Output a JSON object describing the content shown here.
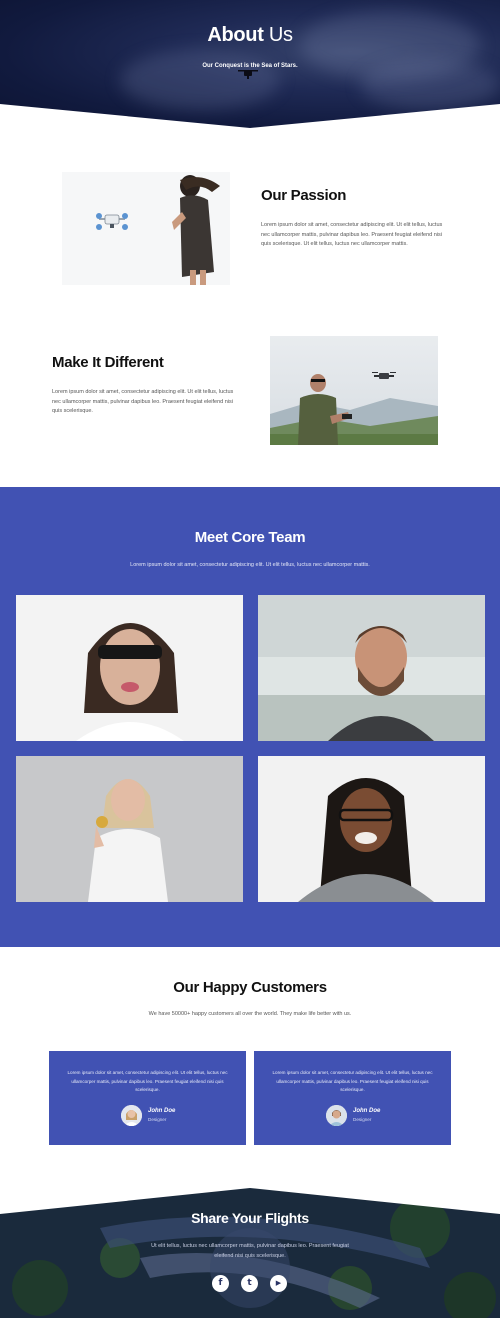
{
  "hero": {
    "title_bold": "About",
    "title_light": " Us",
    "subtitle": "Our Conquest is the Sea of Stars."
  },
  "passion": {
    "heading": "Our Passion",
    "text": "Lorem ipsum dolor sit amet, consectetur adipiscing elit. Ut elit tellus, luctus nec ullamcorper mattis, pulvinar dapibus leo. Praesent feugiat eleifend nisi quis scelerisque. Ut elit tellus, luctus nec ullamcorper mattis."
  },
  "different": {
    "heading": "Make It Different",
    "text": "Lorem ipsum dolor sit amet, consectetur adipiscing elit. Ut elit tellus, luctus nec ullamcorper mattis, pulvinar dapibus leo. Praesent feugiat eleifend nisi quis scelerisque."
  },
  "team": {
    "heading": "Meet Core Team",
    "text": "Lorem ipsum dolor sit amet, consectetur adipiscing elit. Ut elit tellus, luctus nec ullamcorper mattis.",
    "accent": "#4152b3"
  },
  "customers": {
    "heading": "Our Happy Customers",
    "subtitle": "We have 50000+ happy customers all over the world. They make life better with us.",
    "testimonials": [
      {
        "text": "Lorem ipsum dolor sit amet, consectetur adipiscing elit. Ut elit tellus, luctus nec ullamcorper mattis, pulvinar dapibus leo. Praesent feugiat eleifend nisi quis scelerisque.",
        "name": "John Doe",
        "role": "Designer"
      },
      {
        "text": "Lorem ipsum dolor sit amet, consectetur adipiscing elit. Ut elit tellus, luctus nec ullamcorper mattis, pulvinar dapibus leo. Praesent feugiat eleifend nisi quis scelerisque.",
        "name": "John Doe",
        "role": "Designer"
      }
    ]
  },
  "footer": {
    "heading": "Share Your Flights",
    "text": "Ut elit tellus, luctus nec ullamcorper mattis, pulvinar dapibus leo. Praesent feugiat eleifend nisi quis scelerisque.",
    "social": [
      {
        "icon": "facebook-icon",
        "glyph": "f"
      },
      {
        "icon": "twitter-icon",
        "glyph": "t"
      },
      {
        "icon": "youtube-icon",
        "glyph": "▶"
      }
    ]
  }
}
